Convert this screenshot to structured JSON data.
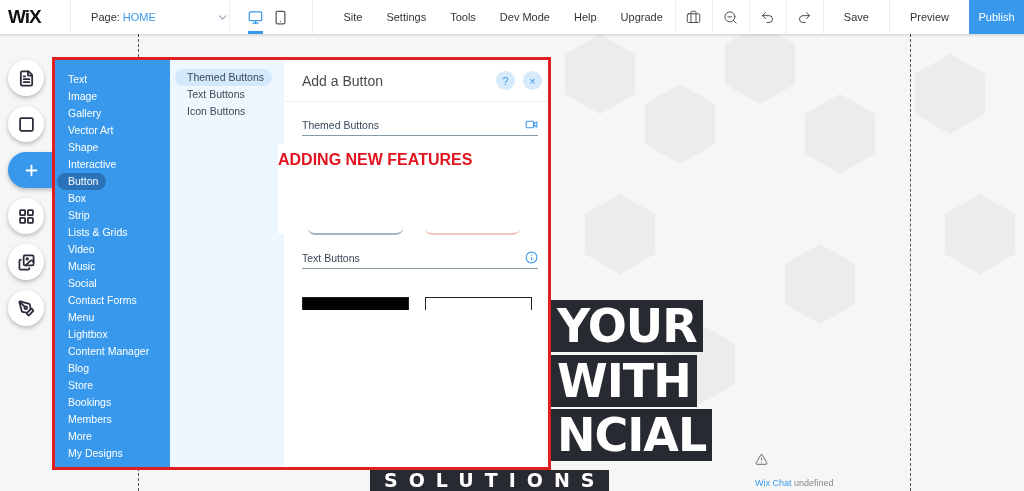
{
  "topbar": {
    "logo": "WiX",
    "page": {
      "label": "Page:",
      "value": "HOME"
    },
    "views": [
      {
        "kind": "desktop",
        "selected": true
      },
      {
        "kind": "mobile",
        "selected": false
      }
    ],
    "menu": [
      "Site",
      "Settings",
      "Tools",
      "Dev Mode",
      "Help",
      "Upgrade"
    ],
    "tools": [
      {
        "kind": "toolbox"
      },
      {
        "kind": "zoom-out"
      },
      {
        "kind": "undo"
      },
      {
        "kind": "redo"
      }
    ],
    "actions": [
      "Save",
      "Preview"
    ],
    "publish": "Publish"
  },
  "rail": [
    {
      "kind": "pages",
      "selected": false
    },
    {
      "kind": "background",
      "selected": false
    },
    {
      "kind": "add",
      "selected": true
    },
    {
      "kind": "apps",
      "selected": false
    },
    {
      "kind": "media",
      "selected": false
    },
    {
      "kind": "pen",
      "selected": false
    }
  ],
  "panel": {
    "categories": [
      {
        "label": "Text",
        "selected": false
      },
      {
        "label": "Image",
        "selected": false
      },
      {
        "label": "Gallery",
        "selected": false
      },
      {
        "label": "Vector Art",
        "selected": false
      },
      {
        "label": "Shape",
        "selected": false
      },
      {
        "label": "Interactive",
        "selected": false
      },
      {
        "label": "Button",
        "selected": true
      },
      {
        "label": "Box",
        "selected": false
      },
      {
        "label": "Strip",
        "selected": false
      },
      {
        "label": "Lists & Grids",
        "selected": false
      },
      {
        "label": "Video",
        "selected": false
      },
      {
        "label": "Music",
        "selected": false
      },
      {
        "label": "Social",
        "selected": false
      },
      {
        "label": "Contact Forms",
        "selected": false
      },
      {
        "label": "Menu",
        "selected": false
      },
      {
        "label": "Lightbox",
        "selected": false
      },
      {
        "label": "Content Manager",
        "selected": false
      },
      {
        "label": "Blog",
        "selected": false
      },
      {
        "label": "Store",
        "selected": false
      },
      {
        "label": "Bookings",
        "selected": false
      },
      {
        "label": "Members",
        "selected": false
      },
      {
        "label": "More",
        "selected": false
      },
      {
        "label": "My Designs",
        "selected": false
      }
    ],
    "subcategories": [
      {
        "label": "Themed Buttons",
        "selected": true
      },
      {
        "label": "Text Buttons",
        "selected": false
      },
      {
        "label": "Icon Buttons",
        "selected": false
      }
    ],
    "title": "Add a Button",
    "help": "?",
    "close": "×",
    "sections": [
      {
        "title": "Themed Buttons",
        "kind": "video"
      },
      {
        "title": "Text Buttons",
        "kind": "info"
      }
    ],
    "annotation": "ADDING NEW FEATURES"
  },
  "canvas": {
    "headline": [
      "YOUR",
      "WITH",
      "NCIAL",
      "SOLUTIONS"
    ],
    "chat": {
      "link": "Wix Chat",
      "text": "undefined"
    }
  }
}
